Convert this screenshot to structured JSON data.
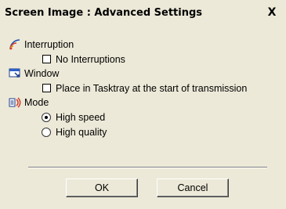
{
  "window": {
    "title": "Screen Image : Advanced Settings",
    "close_label": "X"
  },
  "sections": {
    "interruption": {
      "label": "Interruption",
      "icon": "interruption-icon",
      "option_label": "No Interruptions",
      "checked": false
    },
    "window": {
      "label": "Window",
      "icon": "window-icon",
      "option_label": "Place in Tasktray at the start of transmission",
      "checked": false
    },
    "mode": {
      "label": "Mode",
      "icon": "mode-icon",
      "options": [
        "High speed",
        "High quality"
      ],
      "selected": "High speed"
    }
  },
  "buttons": {
    "ok_label": "OK",
    "cancel_label": "Cancel"
  }
}
